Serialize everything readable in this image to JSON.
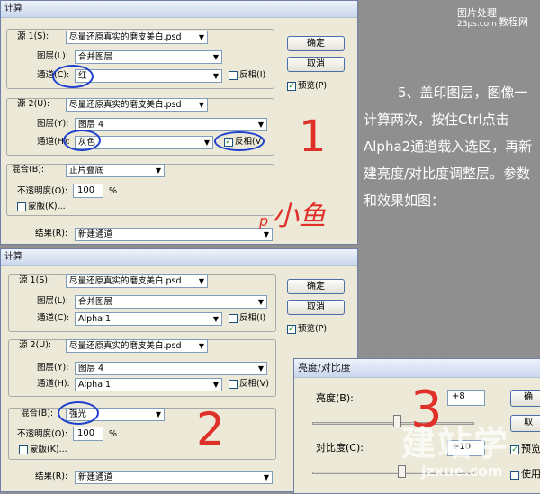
{
  "watermark_top": {
    "line1": "图片处理",
    "line2": "23ps.com",
    "line3": "教程网"
  },
  "article": {
    "text": "5、盖印图层，图像一计算两次，按住Ctrl点击Alpha2通道载入选区，再新建亮度/对比度调整层。参数和效果如图："
  },
  "dialog1": {
    "title": "计算",
    "source1_label": "源 1(S):",
    "source1_value": "尽量还原真实的磨皮美白.psd",
    "layer1_label": "图层(L):",
    "layer1_value": "合并图层",
    "channel1_label": "通道(C):",
    "channel1_value": "红",
    "invert1_label": "反相(I)",
    "invert1_checked": false,
    "source2_label": "源 2(U):",
    "source2_value": "尽量还原真实的磨皮美白.psd",
    "layer2_label": "图层(Y):",
    "layer2_value": "图层 4",
    "channel2_label": "通道(H):",
    "channel2_value": "灰色",
    "invert2_label": "反相(V)",
    "invert2_checked": true,
    "blend_label": "混合(B):",
    "blend_value": "正片叠底",
    "opacity_label": "不透明度(O):",
    "opacity_value": "100",
    "opacity_unit": "%",
    "mask_label": "蒙版(K)...",
    "result_label": "结果(R):",
    "result_value": "新建通道",
    "ok_label": "确定",
    "cancel_label": "取消",
    "preview_label": "预览(P)",
    "preview_checked": true
  },
  "dialog2": {
    "title": "计算",
    "source1_label": "源 1(S):",
    "source1_value": "尽量还原真实的磨皮美白.psd",
    "layer1_label": "图层(L):",
    "layer1_value": "合并图层",
    "channel1_label": "通道(C):",
    "channel1_value": "Alpha 1",
    "invert1_label": "反相(I)",
    "invert1_checked": false,
    "source2_label": "源 2(U):",
    "source2_value": "尽量还原真实的磨皮美白.psd",
    "layer2_label": "图层(Y):",
    "layer2_value": "图层 4",
    "channel2_label": "通道(H):",
    "channel2_value": "Alpha 1",
    "invert2_label": "反相(V)",
    "invert2_checked": false,
    "blend_label": "混合(B):",
    "blend_value": "强光",
    "opacity_label": "不透明度(O):",
    "opacity_value": "100",
    "opacity_unit": "%",
    "mask_label": "蒙版(K)...",
    "result_label": "结果(R):",
    "result_value": "新建通道",
    "ok_label": "确定",
    "cancel_label": "取消",
    "preview_label": "预览(P)",
    "preview_checked": true
  },
  "dialog3": {
    "title": "亮度/对比度",
    "brightness_label": "亮度(B):",
    "brightness_value": "+8",
    "contrast_label": "对比度(C):",
    "contrast_value": "+10",
    "ok_label": "确",
    "cancel_label": "取",
    "preview_label": "预览",
    "legacy_label": "使用",
    "brightness_fraction": 0.52,
    "contrast_fraction": 0.55
  },
  "annotations": {
    "num1": "1",
    "num2": "2",
    "num3": "3",
    "author_sig": "小鱼",
    "author_prefix": "p"
  },
  "watermark_bottom": {
    "brand": "建站学",
    "url": "jzxue.com"
  },
  "colors": {
    "annotation_red": "#e0302a",
    "annotation_blue": "#1e3fd0",
    "background": "#8f8f8f"
  }
}
